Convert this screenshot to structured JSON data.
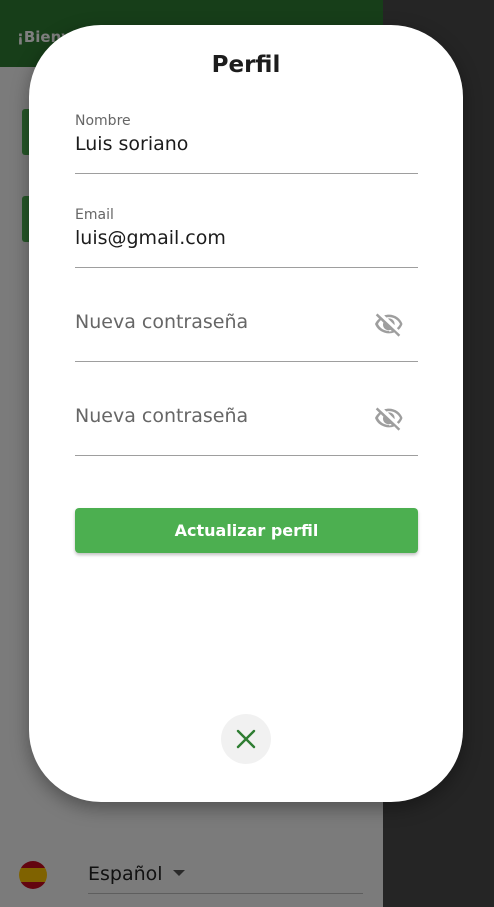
{
  "background": {
    "drawer": {
      "greeting": "¡Bienv",
      "language": {
        "flag_icon": "spain-flag-icon",
        "selected": "Español"
      }
    }
  },
  "dialog": {
    "title": "Perfil",
    "fields": {
      "name": {
        "label": "Nombre",
        "value": "Luis soriano"
      },
      "email": {
        "label": "Email",
        "value": "luis@gmail.com"
      },
      "new_password": {
        "placeholder": "Nueva contraseña",
        "icon": "eye-off-icon"
      },
      "confirm_password": {
        "placeholder": "Nueva contraseña",
        "icon": "eye-off-icon"
      }
    },
    "update_button": "Actualizar perfil",
    "close_icon": "close-icon"
  },
  "colors": {
    "primary": "#4caf50",
    "primary_dark": "#2e7d32",
    "close_icon": "#2e7d32",
    "icon_grey": "#9e9e9e"
  }
}
